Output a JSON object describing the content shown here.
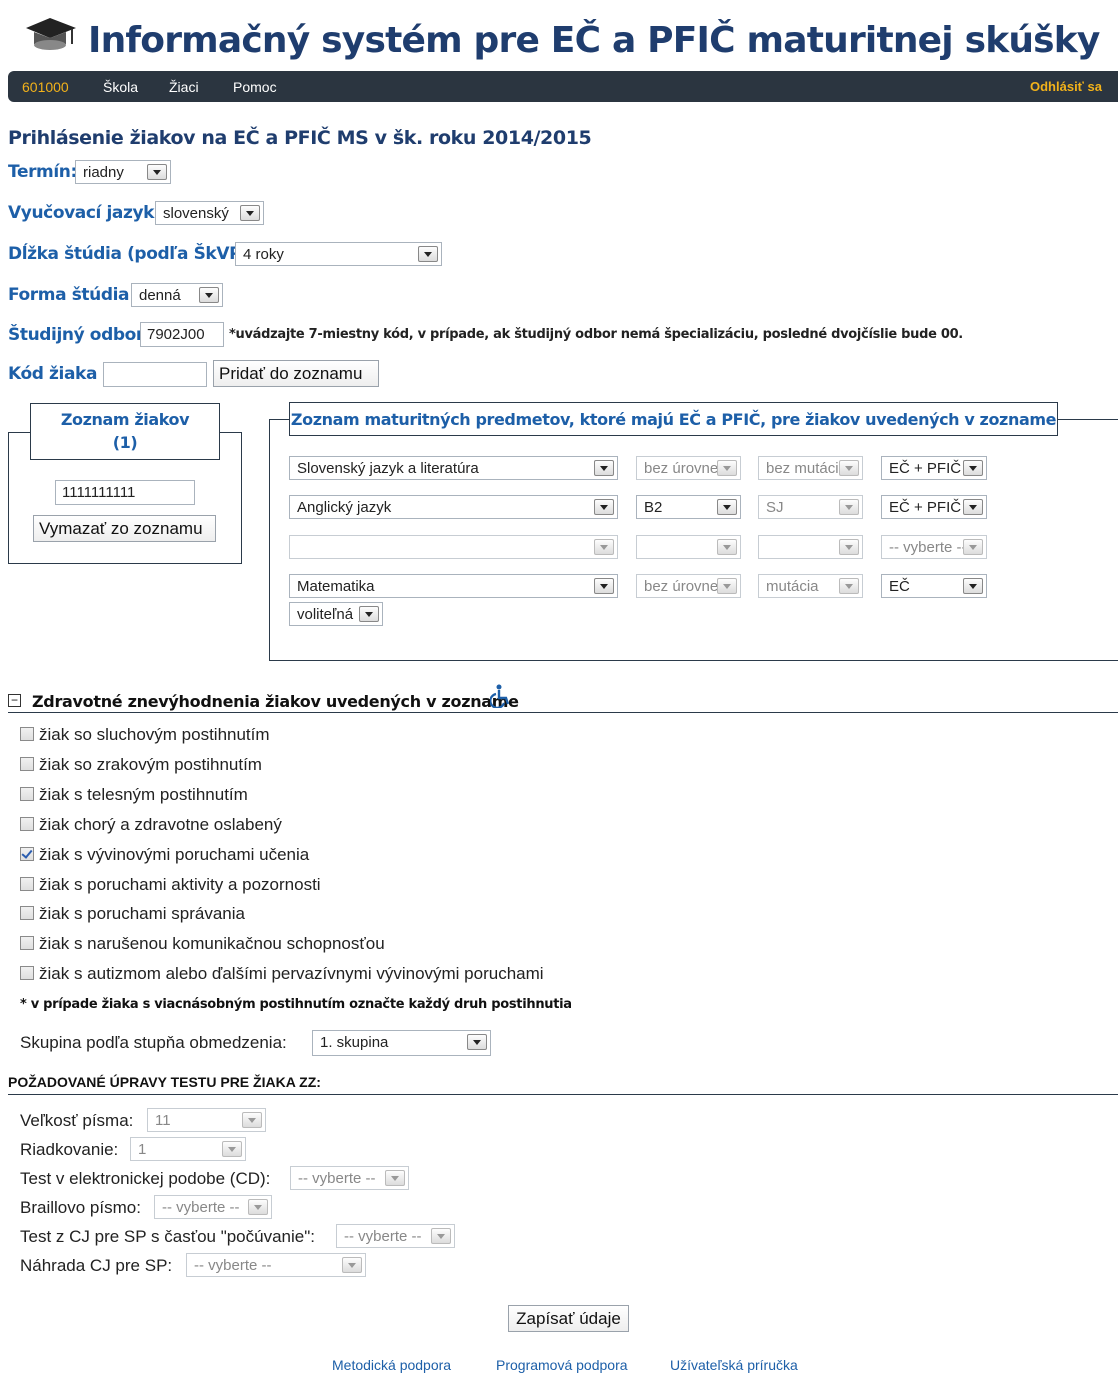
{
  "header": {
    "title": "Informačný systém pre EČ a PFIČ maturitnej skúšky"
  },
  "nav": {
    "code": "601000",
    "items": [
      "Škola",
      "Žiaci",
      "Pomoc"
    ],
    "logout": "Odhlásiť sa"
  },
  "page": {
    "heading": "Prihlásenie žiakov na EČ a PFIČ MS v šk. roku 2014/2015"
  },
  "form": {
    "termin_label": "Termín:",
    "termin_value": "riadny",
    "jazyk_label": "Vyučovací jazyk :",
    "jazyk_value": "slovenský",
    "dlzka_label": "Dĺžka štúdia (podľa ŠkVP):",
    "dlzka_value": "4 roky",
    "forma_label": "Forma štúdia :",
    "forma_value": "denná",
    "odbor_label": "Študijný odbor :",
    "odbor_value": "7902J00",
    "odbor_note": "*uvádzajte 7-miestny kód, v prípade, ak študijný odbor nemá špecializáciu, posledné dvojčíslie bude 00.",
    "kod_label": "Kód žiaka :",
    "kod_value": "",
    "add_button": "Pridať do zoznamu"
  },
  "students": {
    "legend": "Zoznam žiakov",
    "count": "(1)",
    "items": [
      "1111111111"
    ],
    "remove_button": "Vymazať zo zoznamu"
  },
  "subjects": {
    "legend": "Zoznam maturitných predmetov, ktoré majú EČ a PFIČ, pre žiakov uvedených v zozname",
    "rows": [
      {
        "subject": "Slovenský jazyk a literatúra",
        "level": "bez úrovne",
        "mutation": "bez mutácie",
        "part": "EČ + PFIČ"
      },
      {
        "subject": "Anglický jazyk",
        "level": "B2",
        "mutation": "SJ",
        "part": "EČ + PFIČ"
      },
      {
        "subject": "",
        "level": "",
        "mutation": "",
        "part": "-- vyberte --"
      },
      {
        "subject": "Matematika",
        "level": "bez úrovne",
        "mutation": "mutácia",
        "part": "EČ"
      }
    ],
    "optional": "voliteľná"
  },
  "health": {
    "title": "Zdravotné znevýhodnenia žiakov uvedených v zozname",
    "toggle": "−",
    "items": [
      {
        "label": "žiak so sluchovým postihnutím",
        "checked": false
      },
      {
        "label": "žiak so zrakovým postihnutím",
        "checked": false
      },
      {
        "label": "žiak s telesným postihnutím",
        "checked": false
      },
      {
        "label": "žiak chorý a zdravotne oslabený",
        "checked": false
      },
      {
        "label": "žiak s vývinovými poruchami učenia",
        "checked": true
      },
      {
        "label": "žiak s poruchami aktivity a pozornosti",
        "checked": false
      },
      {
        "label": "žiak s poruchami správania",
        "checked": false
      },
      {
        "label": "žiak s narušenou komunikačnou schopnosťou",
        "checked": false
      },
      {
        "label": "žiak s autizmom alebo ďalšími pervazívnymi vývinovými poruchami",
        "checked": false
      }
    ],
    "note": "* v prípade žiaka s viacnásobným postihnutím označte každý druh postihnutia",
    "group_label": "Skupina podľa stupňa obmedzenia:",
    "group_value": "1. skupina"
  },
  "adjust": {
    "title": "POŽADOVANÉ ÚPRAVY TESTU PRE ŽIAKA ZZ:",
    "font_label": "Veľkosť písma:",
    "font_value": "11",
    "spacing_label": "Riadkovanie:",
    "spacing_value": "1",
    "cd_label": "Test v elektronickej podobe (CD):",
    "cd_value": "-- vyberte --",
    "braille_label": "Braillovo písmo:",
    "braille_value": "-- vyberte --",
    "listen_label": "Test z CJ pre SP s časťou \"počúvanie\":",
    "listen_value": "-- vyberte --",
    "replace_label": "Náhrada CJ pre SP:",
    "replace_value": "-- vyberte --"
  },
  "submit": "Zapísať údaje",
  "footer": [
    "Metodická podpora",
    "Programová podpora",
    "Užívateľská príručka"
  ],
  "colors": {
    "navbar": "#2b3540",
    "accent": "#f2b21a",
    "label": "#1d5fa8",
    "title": "#1f3d6e"
  }
}
